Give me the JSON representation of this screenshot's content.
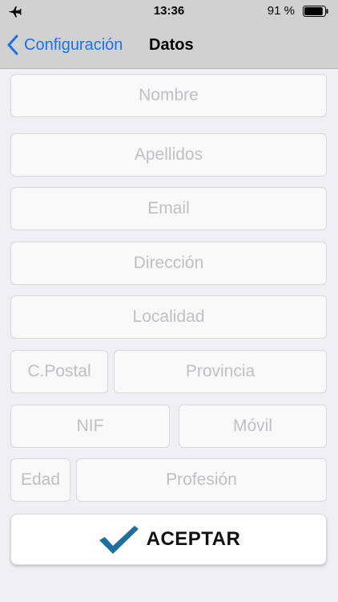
{
  "status_bar": {
    "time": "13:36",
    "battery_percent": "91 %",
    "battery_level": 0.91
  },
  "nav": {
    "back_label": "Configuración",
    "title": "Datos"
  },
  "form": {
    "nombre_placeholder": "Nombre",
    "apellidos_placeholder": "Apellidos",
    "email_placeholder": "Email",
    "direccion_placeholder": "Dirección",
    "localidad_placeholder": "Localidad",
    "cpostal_placeholder": "C.Postal",
    "provincia_placeholder": "Provincia",
    "nif_placeholder": "NIF",
    "movil_placeholder": "Móvil",
    "edad_placeholder": "Edad",
    "profesion_placeholder": "Profesión"
  },
  "accept_button": {
    "label": "ACEPTAR",
    "icon": "checkmark-icon",
    "icon_color": "#1e6fa0"
  },
  "colors": {
    "bar_background": "#d1d1d1",
    "link": "#1a73e8",
    "page_background": "#efeff4"
  }
}
